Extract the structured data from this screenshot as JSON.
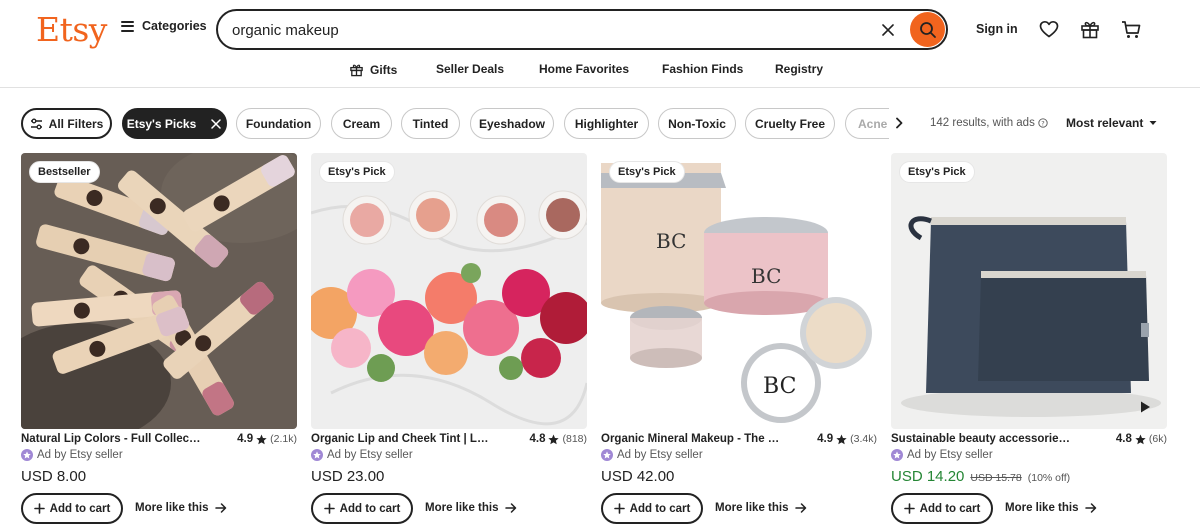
{
  "header": {
    "logo": "Etsy",
    "categories_label": "Categories",
    "search_value": "organic makeup",
    "sign_in": "Sign in"
  },
  "subnav": {
    "items": [
      "Gifts",
      "Seller Deals",
      "Home Favorites",
      "Fashion Finds",
      "Registry"
    ]
  },
  "filters": {
    "all_filters": "All Filters",
    "active": "Etsy's Picks",
    "chips": [
      "Foundation",
      "Cream",
      "Tinted",
      "Eyeshadow",
      "Highlighter",
      "Non-Toxic",
      "Cruelty Free",
      "Acne S"
    ],
    "results": "142 results, with ads",
    "sort": "Most relevant"
  },
  "listings": [
    {
      "badge": "Bestseller",
      "title": "Natural Lip Colors - Full Collection",
      "rating": "4.9",
      "reviews": "(2.1k)",
      "seller": "Ad by Etsy seller",
      "price": "USD 8.00",
      "add_to_cart": "Add to cart",
      "more_like_this": "More like this"
    },
    {
      "badge": "Etsy's Pick",
      "title": "Organic Lip and Cheek Tint | Lip and Cheek",
      "rating": "4.8",
      "reviews": "(818)",
      "seller": "Ad by Etsy seller",
      "price": "USD 23.00",
      "add_to_cart": "Add to cart",
      "more_like_this": "More like this"
    },
    {
      "badge": "Etsy's Pick",
      "title": "Organic Mineral Makeup - The Basics",
      "rating": "4.9",
      "reviews": "(3.4k)",
      "seller": "Ad by Etsy seller",
      "price": "USD 42.00",
      "add_to_cart": "Add to cart",
      "more_like_this": "More like this"
    },
    {
      "badge": "Etsy's Pick",
      "title": "Sustainable beauty accessories. Linen",
      "rating": "4.8",
      "reviews": "(6k)",
      "seller": "Ad by Etsy seller",
      "price": "USD 14.20",
      "original_price": "USD 15.78",
      "discount": "(10% off)",
      "add_to_cart": "Add to cart",
      "more_like_this": "More like this"
    }
  ],
  "colors": {
    "brand": "#f1641e",
    "sale_green": "#258635",
    "star": "#222222"
  }
}
